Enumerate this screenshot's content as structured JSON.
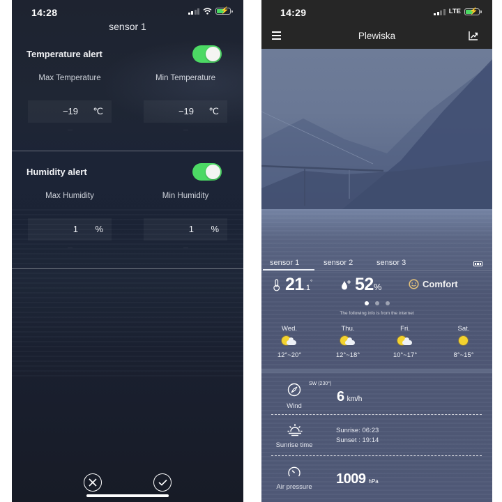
{
  "left_screen": {
    "status_bar": {
      "time": "14:28",
      "network": "wifi",
      "battery_charging": true
    },
    "title": "sensor 1",
    "temperature_alert": {
      "label": "Temperature alert",
      "enabled": true,
      "max": {
        "label": "Max Temperature",
        "value": "−19",
        "unit": "℃"
      },
      "min": {
        "label": "Min Temperature",
        "value": "−19",
        "unit": "℃"
      }
    },
    "humidity_alert": {
      "label": "Humidity alert",
      "enabled": true,
      "max": {
        "label": "Max Humidity",
        "value": "1",
        "unit": "%"
      },
      "min": {
        "label": "Min Humidity",
        "value": "1",
        "unit": "%"
      }
    },
    "actions": {
      "cancel_icon": "close-circle-icon",
      "confirm_icon": "check-circle-icon"
    }
  },
  "right_screen": {
    "status_bar": {
      "time": "14:29",
      "network": "LTE",
      "battery_charging": true
    },
    "header": {
      "title": "Plewiska",
      "menu_icon": "hamburger-icon",
      "chart_icon": "trend-chart-icon"
    },
    "sensor_tabs": [
      {
        "label": "sensor 1",
        "active": true
      },
      {
        "label": "sensor 2",
        "active": false
      },
      {
        "label": "sensor 3",
        "active": false
      }
    ],
    "current": {
      "temperature_int": "21",
      "temperature_dec": ".1",
      "temperature_unit": "°",
      "humidity": "52",
      "humidity_unit": "%",
      "comfort": "Comfort"
    },
    "pager": {
      "pages": 3,
      "active": 1
    },
    "internet_note": "The following info is from the internet",
    "forecast": [
      {
        "day": "Wed.",
        "icon": "partly-cloudy",
        "range": "12°~20°"
      },
      {
        "day": "Thu.",
        "icon": "partly-cloudy",
        "range": "12°~18°"
      },
      {
        "day": "Fri.",
        "icon": "partly-cloudy",
        "range": "10°~17°"
      },
      {
        "day": "Sat.",
        "icon": "sunny",
        "range": "8°~15°"
      }
    ],
    "wind": {
      "label": "Wind",
      "direction": "SW (230°)",
      "speed": "6",
      "unit": "km/h"
    },
    "sun": {
      "label": "Sunrise time",
      "sunrise": "Sunrise: 06:23",
      "sunset": "Sunset : 19:14"
    },
    "pressure": {
      "label": "Air pressure",
      "value": "1009",
      "unit": "hPa"
    }
  }
}
